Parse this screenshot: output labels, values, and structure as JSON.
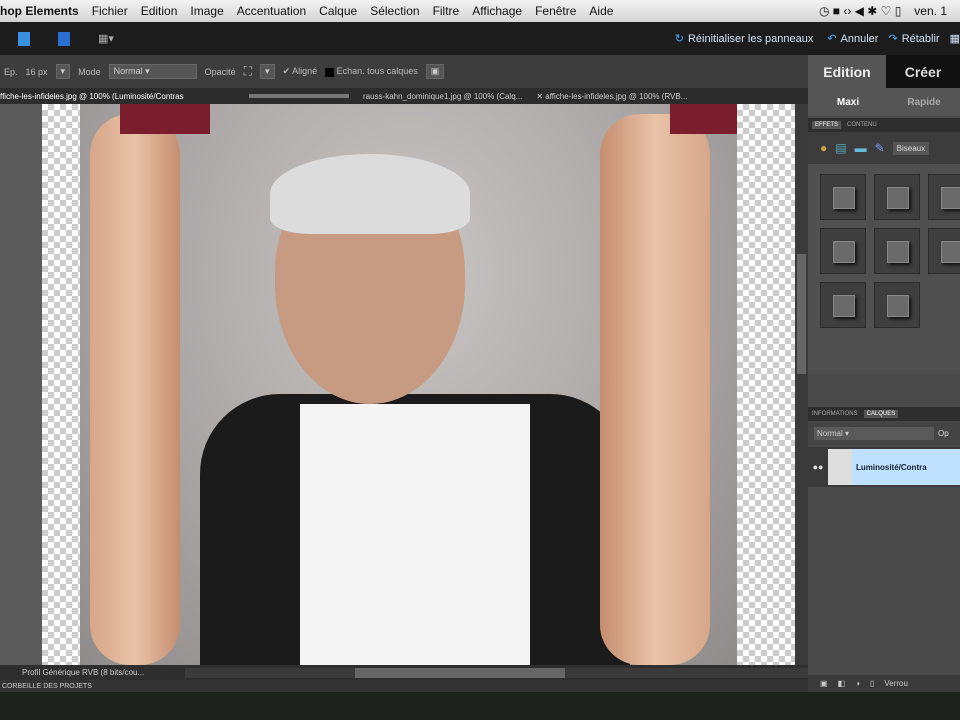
{
  "menubar": {
    "app": "hop Elements",
    "items": [
      "Fichier",
      "Edition",
      "Image",
      "Accentuation",
      "Calque",
      "Sélection",
      "Filtre",
      "Affichage",
      "Fenêtre",
      "Aide"
    ],
    "clock": "ven. 1"
  },
  "toolbar": {
    "reset": "Réinitialiser les panneaux",
    "undo": "Annuler",
    "redo": "Rétablir"
  },
  "options": {
    "ep_label": "Ep.",
    "ep_value": "16 px",
    "mode_label": "Mode",
    "mode_value": "Normal",
    "opacity_label": "Opacité",
    "aligned": "Aligné",
    "sample_all": "Echan. tous calques"
  },
  "doc_tabs": [
    "ffiche-les-infideles.jpg @ 100% (Luminosité/Contras",
    "rauss-kahn_dominique1.jpg @ 100% (Calq...",
    "affiche-les-infideles.jpg @ 100% (RVB..."
  ],
  "panel": {
    "tabs": [
      "Edition",
      "Créer"
    ],
    "subtabs": [
      "Maxi",
      "Rapide"
    ],
    "effects_tabs": [
      "EFFETS",
      "CONTENU"
    ],
    "effects_dropdown": "Biseaux",
    "info_tabs": [
      "INFORMATIONS",
      "CALQUES"
    ],
    "blend_mode": "Normal",
    "opacity_label": "Op",
    "layer_name": "Luminosité/Contra",
    "lock_label": "Verrou"
  },
  "status": {
    "profile": "Profil Générique RVB (8 bits/cou..."
  },
  "project_bin": "CORBEILLE DES PROJETS",
  "colors": {
    "accent": "#8ec5f5",
    "layer_highlight": "#bfe0ff"
  }
}
